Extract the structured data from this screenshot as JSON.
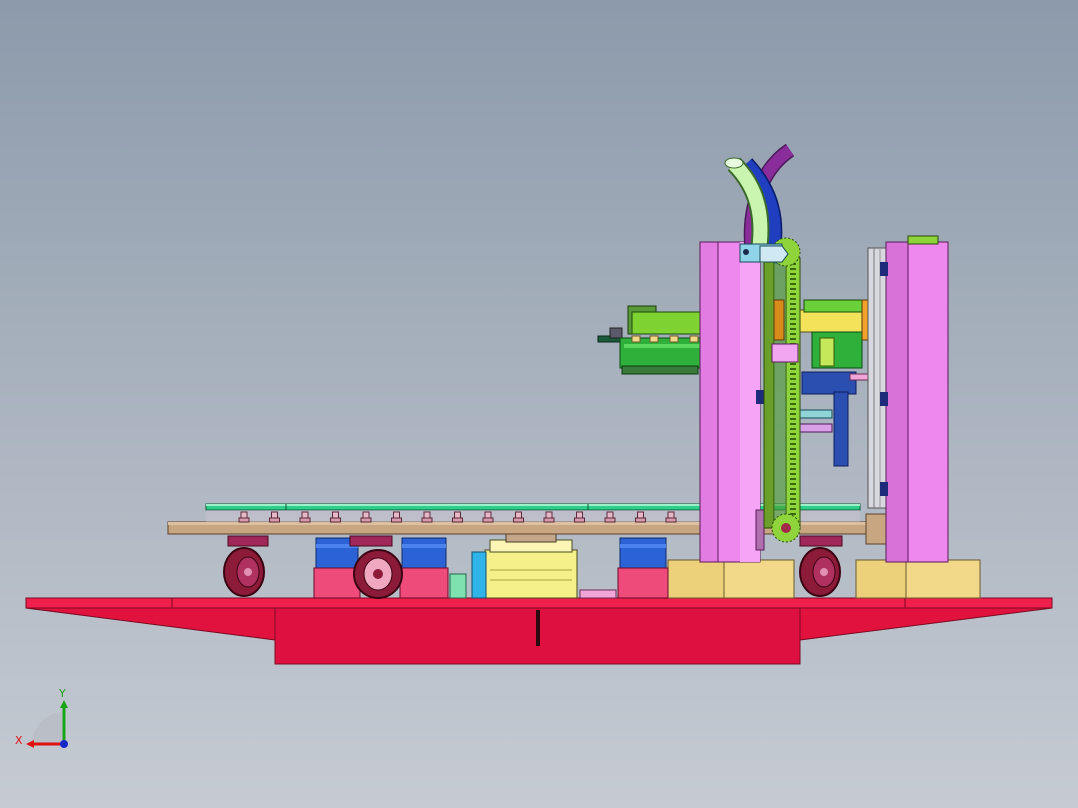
{
  "viewport": {
    "background_top": "#8c9aab",
    "background_bottom": "#c6cbd3"
  },
  "model_colors": {
    "base": "#e2123f",
    "column": "#ee88ee",
    "gear_rail": "#8fd43a",
    "shelf": "#c8a682",
    "glass_plate": "#2ecf8a",
    "motor": "#2b63d6",
    "pedestal": "#f2d98a",
    "hose_light": "#c9f5b0",
    "hose_blue": "#1f3fc0",
    "hose_purple": "#8a2d9a",
    "caster": "#8c1b3a"
  },
  "triad": {
    "x_label": "X",
    "y_label": "Y",
    "x_color": "#e01010",
    "y_color": "#1aa41a",
    "z_color": "#1428c8"
  }
}
